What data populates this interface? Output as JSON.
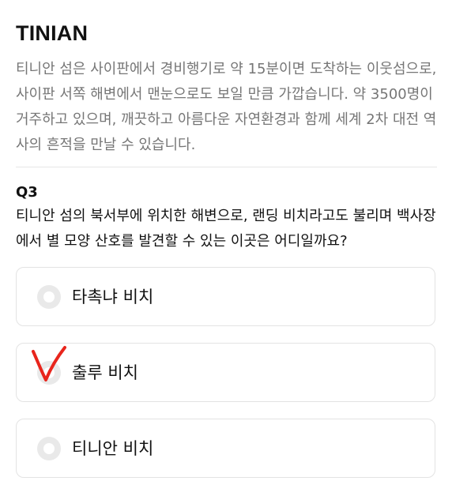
{
  "header": {
    "title": "TINIAN"
  },
  "description": {
    "text": "티니안 섬은 사이판에서 경비행기로 약 15분이면 도착하는 이웃섬으로, 사이판 서쪽 해변에서 맨눈으로도 보일 만큼 가깝습니다. 약 3500명이 거주하고 있으며, 깨끗하고 아름다운 자연환경과 함께 세계 2차 대전 역사의 흔적을 만날 수 있습니다."
  },
  "question": {
    "number": "Q3",
    "text": "티니안 섬의 북서부에 위치한 해변으로, 랜딩 비치라고도 불리며 백사장에서 별 모양 산호를 발견할 수 있는 이곳은 어디일까요?"
  },
  "options": [
    {
      "label": "타촉냐 비치"
    },
    {
      "label": "출루 비치"
    },
    {
      "label": "티니안 비치"
    }
  ],
  "annotation": {
    "icon": "red-check-mark-icon",
    "color": "#e8251c",
    "marked_option": "출루 비치"
  }
}
